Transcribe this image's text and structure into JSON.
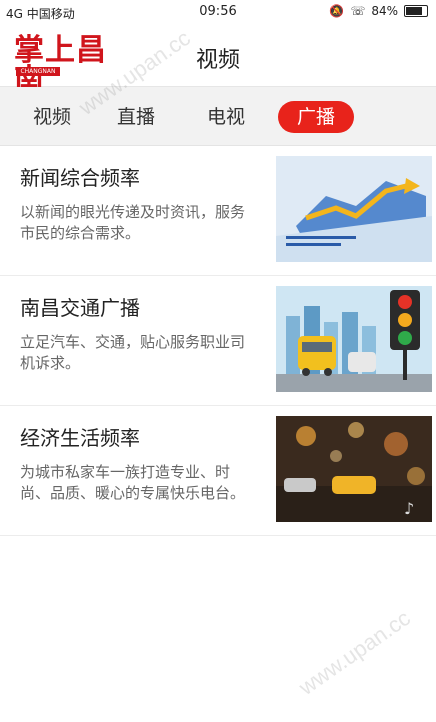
{
  "status_bar": {
    "signal": "4G 中国移动",
    "time": "09:56",
    "battery": "84%"
  },
  "header": {
    "logo_text": "掌上昌南",
    "logo_sub": "CHANGNAN",
    "title": "视频"
  },
  "tabs": [
    {
      "label": "视频",
      "active": false
    },
    {
      "label": "直播",
      "active": false
    },
    {
      "label": "电视",
      "active": false
    },
    {
      "label": "广播",
      "active": true
    }
  ],
  "channels": [
    {
      "name": "新闻综合频率",
      "desc": "以新闻的眼光传递及时资讯，服务市民的综合需求。",
      "thumb_icon": "map-arrow-thumbnail"
    },
    {
      "name": "南昌交通广播",
      "desc": "立足汽车、交通，贴心服务职业司机诉求。",
      "thumb_icon": "traffic-light-thumbnail"
    },
    {
      "name": "经济生活频率",
      "desc": "为城市私家车一族打造专业、时尚、品质、暖心的专属快乐电台。",
      "thumb_icon": "night-street-thumbnail"
    }
  ],
  "colors": {
    "accent": "#e8231b",
    "logo": "#d0151c"
  },
  "watermark": "www.upan.cc"
}
